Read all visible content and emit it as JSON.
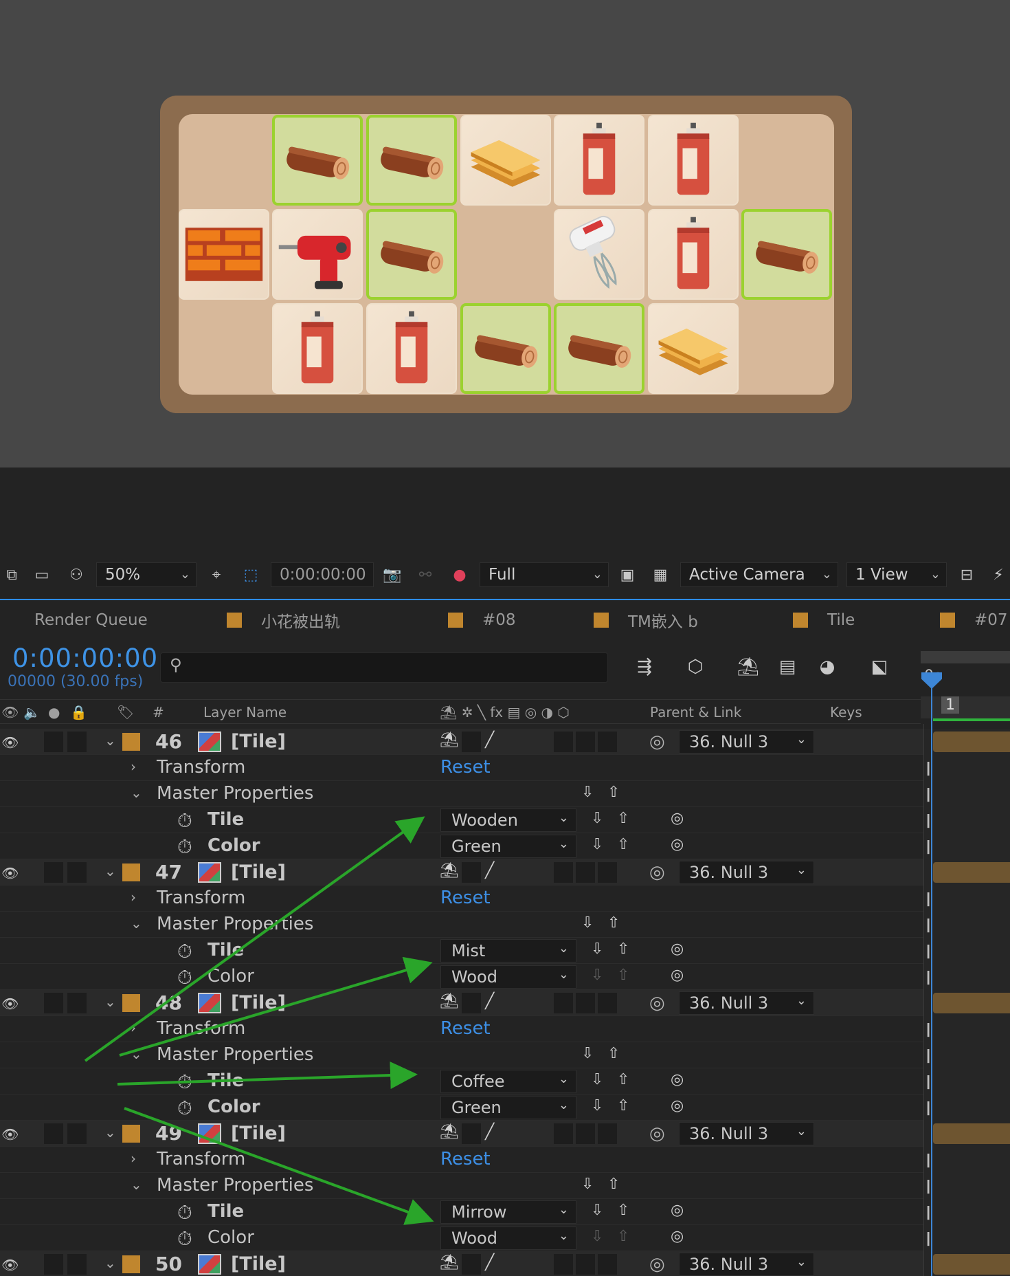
{
  "viewer": {
    "zoom": "50%",
    "timecode": "0:00:00:00",
    "resolution": "Full",
    "camera": "Active Camera",
    "views": "1 View"
  },
  "board": {
    "tiles": [
      {
        "icon": "log",
        "highlighted": true
      },
      {
        "icon": "log",
        "highlighted": true
      },
      {
        "icon": "planks",
        "highlighted": false
      },
      {
        "icon": "spray-can",
        "highlighted": false
      },
      {
        "icon": "spray-can",
        "highlighted": false
      },
      {
        "icon": "bricks",
        "highlighted": false
      },
      {
        "icon": "drill",
        "highlighted": false
      },
      {
        "icon": "log",
        "highlighted": true
      },
      {
        "icon": "mixer",
        "highlighted": false
      },
      {
        "icon": "spray-can",
        "highlighted": false
      },
      {
        "icon": "log",
        "highlighted": true
      },
      {
        "icon": "spray-can",
        "highlighted": false
      },
      {
        "icon": "spray-can",
        "highlighted": false
      },
      {
        "icon": "log",
        "highlighted": true
      },
      {
        "icon": "log",
        "highlighted": true
      },
      {
        "icon": "planks",
        "highlighted": false
      }
    ]
  },
  "tabs": [
    "Render Queue",
    "小花被出轨",
    "#08",
    "TM嵌入 b",
    "Tile",
    "#07"
  ],
  "timeline": {
    "timecode": "0:00:00:00",
    "fps": "00000 (30.00 fps)",
    "search_placeholder": "",
    "ruler_label": "0s",
    "marker": "1",
    "columns": {
      "hash": "#",
      "layer_name": "Layer Name",
      "parent": "Parent & Link",
      "keys": "Keys"
    }
  },
  "layers": [
    {
      "num": "46",
      "name": "[Tile]",
      "parent": "36. Null 3",
      "transform": "Transform",
      "reset": "Reset",
      "master": "Master Properties",
      "tile_label": "Tile",
      "tile_value": "Wooden",
      "color_label": "Color",
      "color_value": "Green"
    },
    {
      "num": "47",
      "name": "[Tile]",
      "parent": "36. Null 3",
      "transform": "Transform",
      "reset": "Reset",
      "master": "Master Properties",
      "tile_label": "Tile",
      "tile_value": "Mist",
      "color_label": "Color",
      "color_value": "Wood"
    },
    {
      "num": "48",
      "name": "[Tile]",
      "parent": "36. Null 3",
      "transform": "Transform",
      "reset": "Reset",
      "master": "Master Properties",
      "tile_label": "Tile",
      "tile_value": "Coffee",
      "color_label": "Color",
      "color_value": "Green"
    },
    {
      "num": "49",
      "name": "[Tile]",
      "parent": "36. Null 3",
      "transform": "Transform",
      "reset": "Reset",
      "master": "Master Properties",
      "tile_label": "Tile",
      "tile_value": "Mirrow",
      "color_label": "Color",
      "color_value": "Wood"
    },
    {
      "num": "50",
      "name": "[Tile]",
      "parent": "36. Null 3"
    }
  ],
  "colors": {
    "accent_blue": "#3d8fe5",
    "label_orange": "#c0862e",
    "annotation_green": "#2aa52a",
    "tile_highlight": "#9bd22f"
  }
}
